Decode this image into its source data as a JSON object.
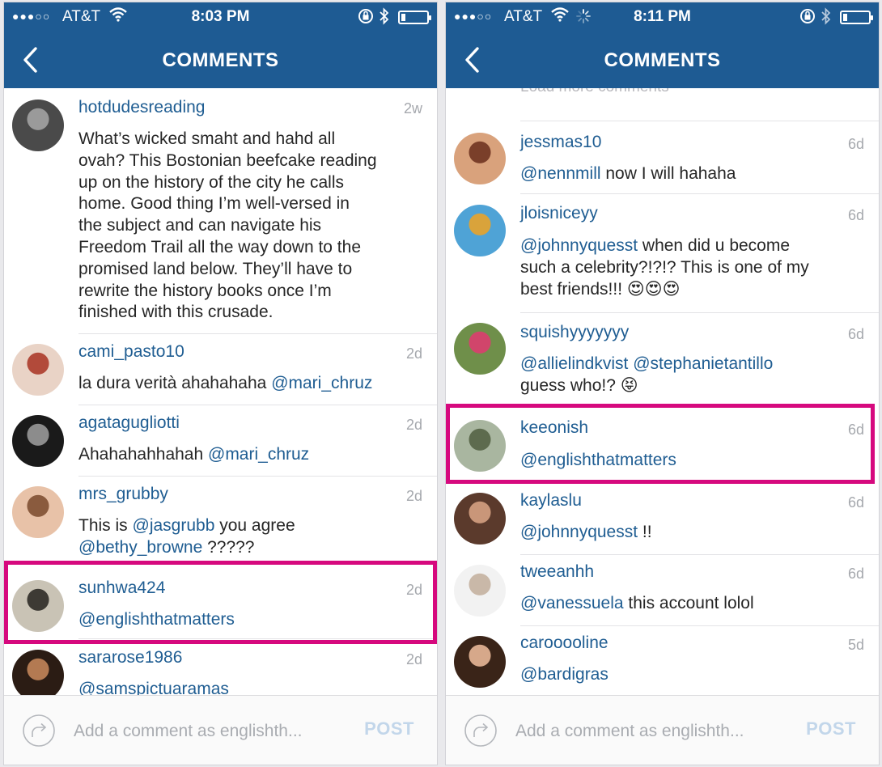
{
  "screens": [
    {
      "status": {
        "carrier": "AT&T",
        "time": "8:03 PM"
      },
      "nav": {
        "title": "COMMENTS"
      },
      "comments": [
        {
          "username": "hotdudesreading",
          "time": "2w",
          "avatar_colors": [
            "#4a4a4a",
            "#9a9a9a"
          ],
          "lines": [
            [
              {
                "t": "What’s wicked smaht and hahd all"
              }
            ],
            [
              {
                "t": "ovah? This Bostonian beefcake reading"
              }
            ],
            [
              {
                "t": "up on the history of the city he calls"
              }
            ],
            [
              {
                "t": "home. Good thing I’m well-versed in"
              }
            ],
            [
              {
                "t": "the subject and can navigate his"
              }
            ],
            [
              {
                "t": "Freedom Trail all the way down to the"
              }
            ],
            [
              {
                "t": "promised land below. They’ll have to"
              }
            ],
            [
              {
                "t": "rewrite the history books once I’m"
              }
            ],
            [
              {
                "t": "finished with this crusade."
              }
            ]
          ]
        },
        {
          "username": "cami_pasto10",
          "time": "2d",
          "avatar_colors": [
            "#e9d3c6",
            "#b24a3a"
          ],
          "lines": [
            [
              {
                "t": "la dura verità ahahahaha "
              },
              {
                "t": "@mari_chruz",
                "m": true
              }
            ]
          ]
        },
        {
          "username": "agatagugliotti",
          "time": "2d",
          "avatar_colors": [
            "#1a1a1a",
            "#8c8c8c"
          ],
          "lines": [
            [
              {
                "t": "Ahahahahhahah "
              },
              {
                "t": "@mari_chruz",
                "m": true
              }
            ]
          ]
        },
        {
          "username": "mrs_grubby",
          "time": "2d",
          "avatar_colors": [
            "#e8c2a8",
            "#8a5b3e"
          ],
          "lines": [
            [
              {
                "t": "This is "
              },
              {
                "t": "@jasgrubb",
                "m": true
              },
              {
                "t": " you agree"
              }
            ],
            [
              {
                "t": "@bethy_browne",
                "m": true
              },
              {
                "t": " ?????"
              }
            ]
          ]
        },
        {
          "username": "sunhwa424",
          "time": "2d",
          "avatar_colors": [
            "#c9c3b5",
            "#3d3a34"
          ],
          "lines": [
            [
              {
                "t": "@englishthatmatters",
                "m": true
              }
            ]
          ]
        },
        {
          "username": "sararose1986",
          "time": "2d",
          "avatar_colors": [
            "#2b1c14",
            "#b37a52"
          ],
          "lines": [
            [
              {
                "t": "@samspictuaramas",
                "m": true
              }
            ]
          ]
        }
      ],
      "footer": {
        "placeholder": "Add a comment as englishth...",
        "post_label": "POST"
      }
    },
    {
      "status": {
        "carrier": "AT&T",
        "time": "8:11 PM"
      },
      "nav": {
        "title": "COMMENTS"
      },
      "load_more": "Load more comments",
      "comments": [
        {
          "username": "jessmas10",
          "time": "6d",
          "avatar_colors": [
            "#d9a27c",
            "#7a3f2a"
          ],
          "lines": [
            [
              {
                "t": "@nennmill",
                "m": true
              },
              {
                "t": " now I will hahaha"
              }
            ]
          ]
        },
        {
          "username": "jloisniceyy",
          "time": "6d",
          "avatar_colors": [
            "#4fa3d6",
            "#d9a33b"
          ],
          "lines": [
            [
              {
                "t": "@johnnyquesst",
                "m": true
              },
              {
                "t": " when did u become"
              }
            ],
            [
              {
                "t": "such a celebrity?!?!? This is one of my"
              }
            ],
            [
              {
                "t": "best friends!!! 😍😍😍"
              }
            ]
          ]
        },
        {
          "username": "squishyyyyyyy",
          "time": "6d",
          "avatar_colors": [
            "#6f8f4a",
            "#d1456b"
          ],
          "lines": [
            [
              {
                "t": "@allielindkvist",
                "m": true
              },
              {
                "t": " "
              },
              {
                "t": "@stephanietantillo",
                "m": true
              }
            ],
            [
              {
                "t": "guess who!? 😝"
              }
            ]
          ]
        },
        {
          "username": "keeonish",
          "time": "6d",
          "avatar_colors": [
            "#a9b6a0",
            "#5d6b4e"
          ],
          "lines": [
            [
              {
                "t": "@englishthatmatters",
                "m": true
              }
            ]
          ]
        },
        {
          "username": "kaylaslu",
          "time": "6d",
          "avatar_colors": [
            "#5b3a2c",
            "#c99679"
          ],
          "lines": [
            [
              {
                "t": "@johnnyquesst",
                "m": true
              },
              {
                "t": " !!"
              }
            ]
          ]
        },
        {
          "username": "tweeanhh",
          "time": "6d",
          "avatar_colors": [
            "#f2f2f2",
            "#c9b8a8"
          ],
          "lines": [
            [
              {
                "t": "@vanessuela",
                "m": true
              },
              {
                "t": " this account lolol"
              }
            ]
          ]
        },
        {
          "username": "carooooline",
          "time": "5d",
          "avatar_colors": [
            "#3a2418",
            "#d6a88a"
          ],
          "lines": [
            [
              {
                "t": "@bardigras",
                "m": true
              }
            ]
          ]
        }
      ],
      "footer": {
        "placeholder": "Add a comment as englishth...",
        "post_label": "POST"
      }
    }
  ],
  "icons": [
    "back-icon",
    "wifi-icon",
    "loading-spinner-icon",
    "rotation-lock-icon",
    "bluetooth-icon",
    "battery-icon",
    "reply-icon"
  ],
  "colors": {
    "nav_blue": "#1e5b93",
    "link_blue": "#1f5d92",
    "highlight": "#d6097e",
    "post_disabled": "#c2d6ea"
  }
}
